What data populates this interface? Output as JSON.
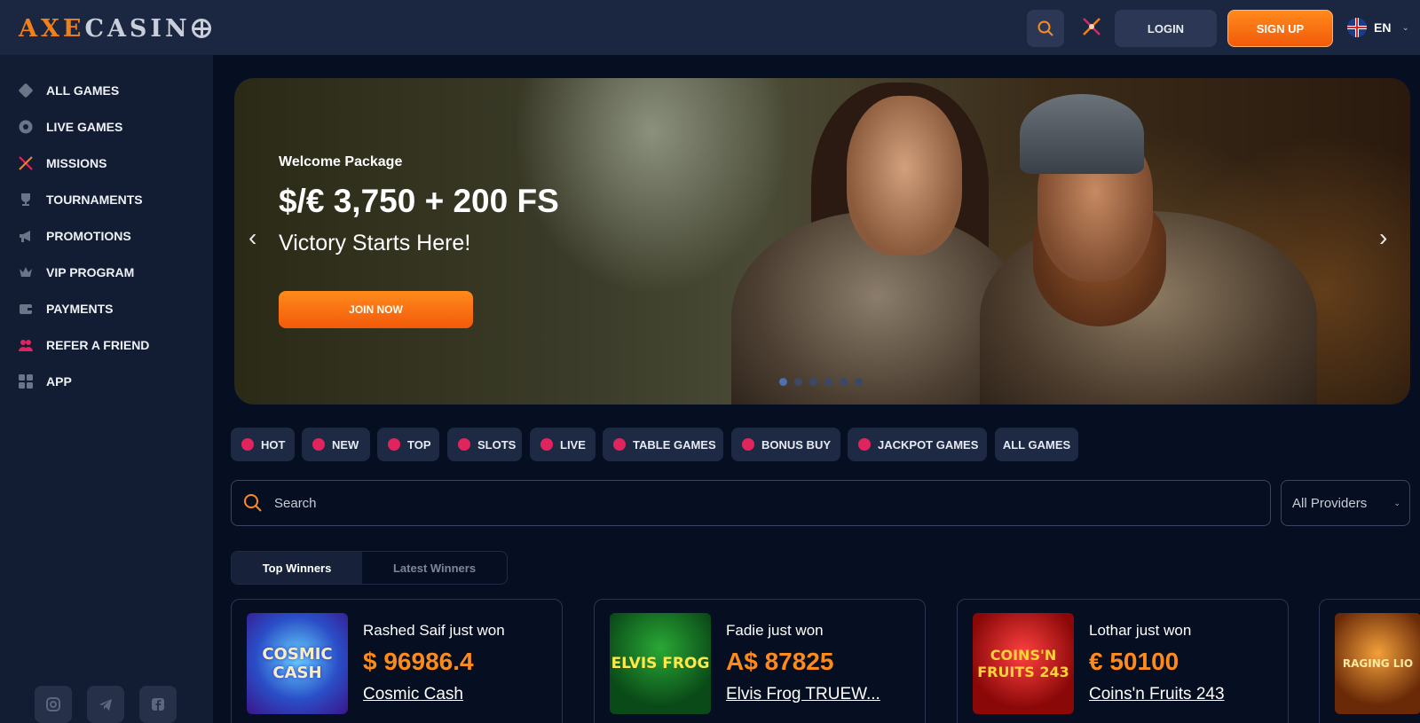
{
  "header": {
    "logo_text_1": "AXE",
    "logo_text_2": "CASIN",
    "login_label": "LOGIN",
    "signup_label": "SIGN UP",
    "language": "EN",
    "accent_color": "#ff8a1c"
  },
  "sidebar": {
    "items": [
      {
        "label": "ALL GAMES",
        "icon": "dice-icon"
      },
      {
        "label": "LIVE GAMES",
        "icon": "roulette-icon"
      },
      {
        "label": "MISSIONS",
        "icon": "crossed-swords-icon"
      },
      {
        "label": "TOURNAMENTS",
        "icon": "trophy-icon"
      },
      {
        "label": "PROMOTIONS",
        "icon": "megaphone-icon"
      },
      {
        "label": "VIP PROGRAM",
        "icon": "crown-icon"
      },
      {
        "label": "PAYMENTS",
        "icon": "wallet-icon"
      },
      {
        "label": "REFER A FRIEND",
        "icon": "users-icon"
      },
      {
        "label": "APP",
        "icon": "grid-icon"
      }
    ],
    "social": [
      "instagram-icon",
      "telegram-icon",
      "facebook-icon"
    ]
  },
  "hero": {
    "eyebrow": "Welcome Package",
    "title": "$/€ 3,750 + 200 FS",
    "subtitle": "Victory Starts Here!",
    "cta": "JOIN NOW",
    "slides": 6,
    "active_slide": 1
  },
  "categories": [
    {
      "label": "HOT",
      "icon": "flame-icon"
    },
    {
      "label": "NEW",
      "icon": "new-badge-icon"
    },
    {
      "label": "TOP",
      "icon": "star-icon"
    },
    {
      "label": "SLOTS",
      "icon": "cherry-icon"
    },
    {
      "label": "LIVE",
      "icon": "chip-icon"
    },
    {
      "label": "TABLE GAMES",
      "icon": "dice-icon"
    },
    {
      "label": "BONUS BUY",
      "icon": "gift-icon"
    },
    {
      "label": "JACKPOT GAMES",
      "icon": "seven-icon"
    },
    {
      "label": "ALL GAMES",
      "icon": ""
    }
  ],
  "search": {
    "placeholder": "Search",
    "value": ""
  },
  "providers": {
    "selected": "All Providers"
  },
  "winner_tabs": {
    "active": "Top Winners",
    "inactive": "Latest Winners"
  },
  "winners": [
    {
      "name": "Rashed Saif just won",
      "amount": "$ 96986.4",
      "game": "Cosmic Cash",
      "thumb_text": "COSMIC CASH"
    },
    {
      "name": "Fadie just won",
      "amount": "A$ 87825",
      "game": "Elvis Frog TRUEW...",
      "thumb_text": "ELVIS FROG"
    },
    {
      "name": "Lothar just won",
      "amount": "€ 50100",
      "game": "Coins'n Fruits 243",
      "thumb_text": "COINS'N FRUITS 243"
    },
    {
      "name": "",
      "amount": "",
      "game": "",
      "thumb_text": "RAGING LIO"
    }
  ]
}
